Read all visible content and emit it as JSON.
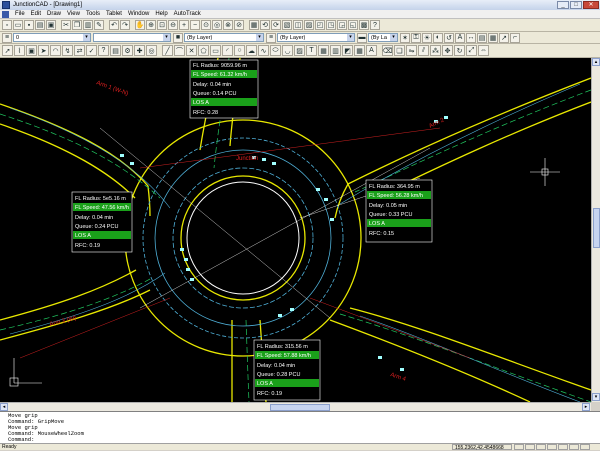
{
  "window": {
    "title": "JunctionCAD - [Drawing1]",
    "minimize": "_",
    "maximize": "□",
    "close": "✕"
  },
  "menu": [
    "File",
    "Edit",
    "Draw",
    "View",
    "Tools",
    "Tablet",
    "Window",
    "Help",
    "AutoTrack"
  ],
  "toolbar2": {
    "layer_value": "0",
    "linetype_label": "(By Layer)",
    "lineweight_label": "(By Layer)",
    "color_label": "(By La"
  },
  "labels": {
    "north": {
      "radius": "FL Radius: 9059.96 m",
      "speed": "FL Speed: 61.32 km/h",
      "delay": "Delay: 0.04 min",
      "queue": "Queue: 0.14 PCU",
      "los": "LOS A",
      "rfc": "RFC: 0.28"
    },
    "west": {
      "radius": "FL Radius: 5e5.16 m",
      "speed": "FL Speed: 47.56 km/h",
      "delay": "Delay: 0.04 min",
      "queue": "Queue: 0.24 PCU",
      "los": "LOS A",
      "rfc": "RFC: 0.19"
    },
    "east": {
      "radius": "FL Radius: 364.95 m",
      "speed": "FL Speed: 56.28 km/h",
      "delay": "Delay: 0.05 min",
      "queue": "Queue: 0.33 PCU",
      "los": "LOS A",
      "rfc": "RFC: 0.15"
    },
    "south": {
      "radius": "FL Radius: 315.56 m",
      "speed": "FL Speed: 57.88 km/h",
      "delay": "Delay: 0.04 min",
      "queue": "Queue: 0.28 PCU",
      "los": "LOS A",
      "rfc": "RFC: 0.19"
    }
  },
  "annotations": {
    "arm_n": "Arm 1 (W-N)",
    "arm_e": "Arm 2",
    "arm_w": "Arm 3 (W)",
    "arm_s": "Arm 4",
    "center": "Junction"
  },
  "command": {
    "lines": [
      "Move grip",
      "Command: GripMove",
      "Move grip",
      "Command: MouseWheelZoom",
      "Command:"
    ]
  },
  "status": {
    "left": "Ready",
    "coords": "155.2362,42.4548668"
  },
  "colors": {
    "canvas": "#000000",
    "road_edge": "#e8e800",
    "kerb": "#4fb0d8",
    "los_fill": "#1aa01a",
    "speed_fill": "#1aa01a"
  }
}
